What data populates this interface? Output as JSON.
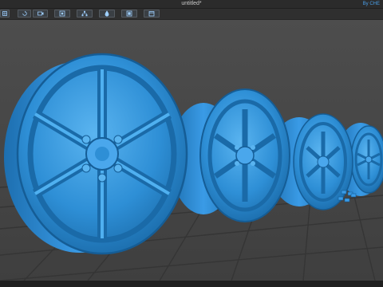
{
  "window": {
    "title": "untitled*",
    "brand": "By CHE"
  },
  "toolbar": {
    "buttons": [
      {
        "icon": "grid-icon"
      },
      {
        "icon": "rotate-icon"
      },
      {
        "icon": "camera-icon"
      },
      {
        "icon": "layers-icon"
      },
      {
        "icon": "structure-icon"
      },
      {
        "icon": "paint-icon"
      },
      {
        "icon": "frame-icon"
      },
      {
        "icon": "calendar-icon"
      }
    ]
  },
  "viewport": {
    "object": "alloy-wheels",
    "model_color": "#2e8fd6",
    "background_color": "#4b4b4b",
    "floor_color": "#5c5c5c"
  },
  "colors": {
    "accent": "#3a9be6",
    "chrome": "#2b2b2b"
  }
}
